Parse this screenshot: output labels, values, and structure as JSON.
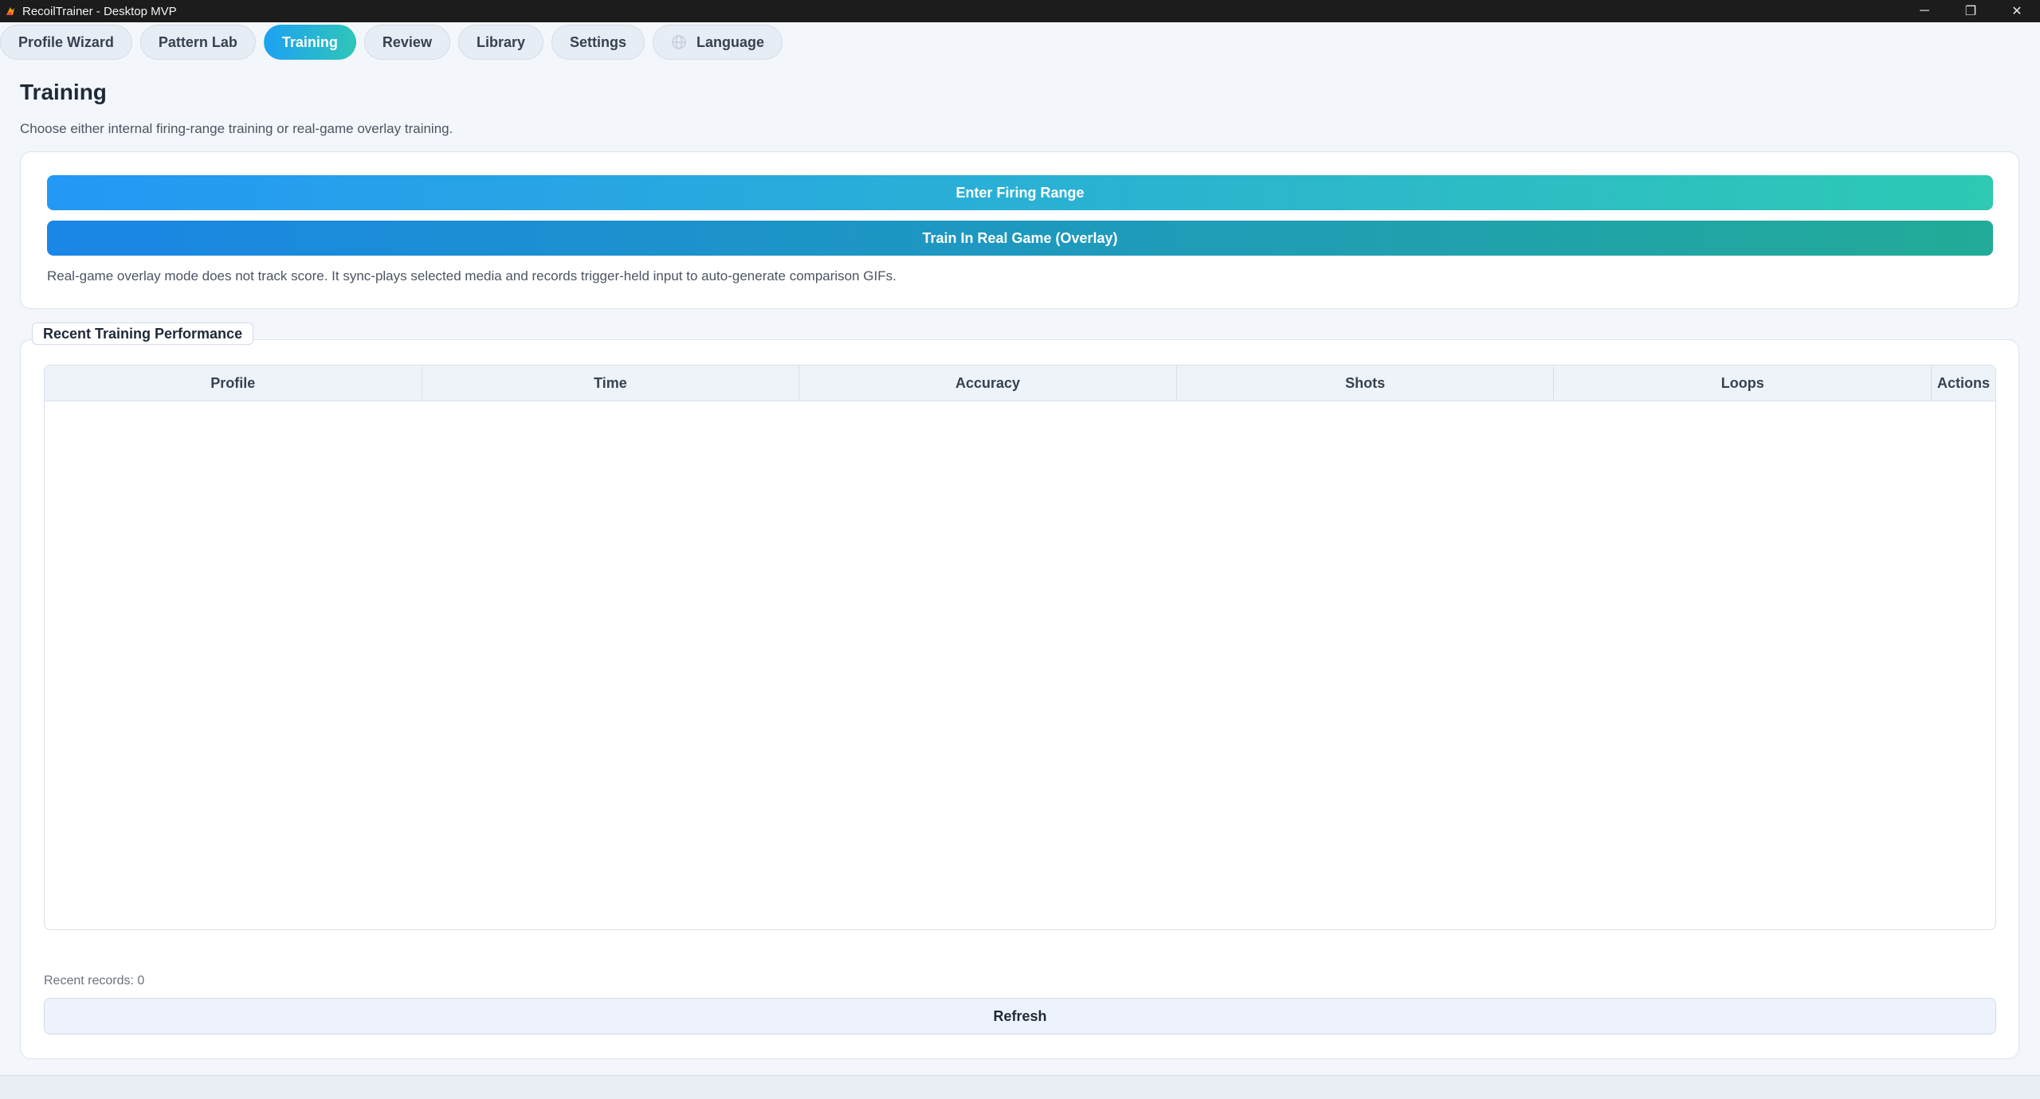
{
  "window": {
    "title": "RecoilTrainer - Desktop MVP",
    "icon": "app-icon",
    "minimize_glyph": "─",
    "maximize_glyph": "❐",
    "close_glyph": "✕"
  },
  "tabs": [
    {
      "label": "Profile Wizard",
      "active": false
    },
    {
      "label": "Pattern Lab",
      "active": false
    },
    {
      "label": "Training",
      "active": true
    },
    {
      "label": "Review",
      "active": false
    },
    {
      "label": "Library",
      "active": false
    },
    {
      "label": "Settings",
      "active": false
    },
    {
      "label": "Language",
      "active": false,
      "icon": "globe-icon"
    }
  ],
  "page": {
    "title": "Training",
    "subtitle": "Choose either internal firing-range training or real-game overlay training."
  },
  "training_actions": {
    "firing_range_label": "Enter Firing Range",
    "overlay_label": "Train In Real Game (Overlay)",
    "hint": "Real-game overlay mode does not track score. It sync-plays selected media and records trigger-held input to auto-generate comparison GIFs."
  },
  "performance": {
    "group_title": "Recent Training Performance",
    "columns": [
      "Profile",
      "Time",
      "Accuracy",
      "Shots",
      "Loops",
      "Actions"
    ],
    "rows": [],
    "records_text": "Recent records: 0",
    "refresh_label": "Refresh"
  },
  "colors": {
    "accent_start": "#1ea1f2",
    "accent_end": "#2ec6b8"
  }
}
